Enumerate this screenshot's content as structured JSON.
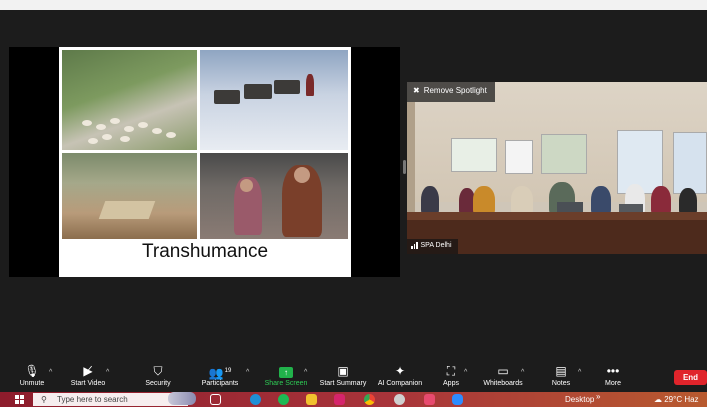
{
  "slide": {
    "title": "Transhumance"
  },
  "video": {
    "spotlight_label": "Remove Spotlight",
    "participant_name": "SPA Delhi"
  },
  "toolbar": {
    "unmute": "Unmute",
    "start_video": "Start Video",
    "security": "Security",
    "participants": "Participants",
    "participants_count": "19",
    "share_screen": "Share Screen",
    "start_summary": "Start Summary",
    "ai_companion": "AI Companion",
    "apps": "Apps",
    "whiteboards": "Whiteboards",
    "notes": "Notes",
    "more": "More",
    "end": "End"
  },
  "taskbar": {
    "search_placeholder": "Type here to search",
    "desktop": "Desktop",
    "weather": "29°C Haz"
  },
  "colors": {
    "end_red": "#e0242b",
    "share_green": "#21b24b",
    "toolbar_bg": "#1c1c1c"
  }
}
